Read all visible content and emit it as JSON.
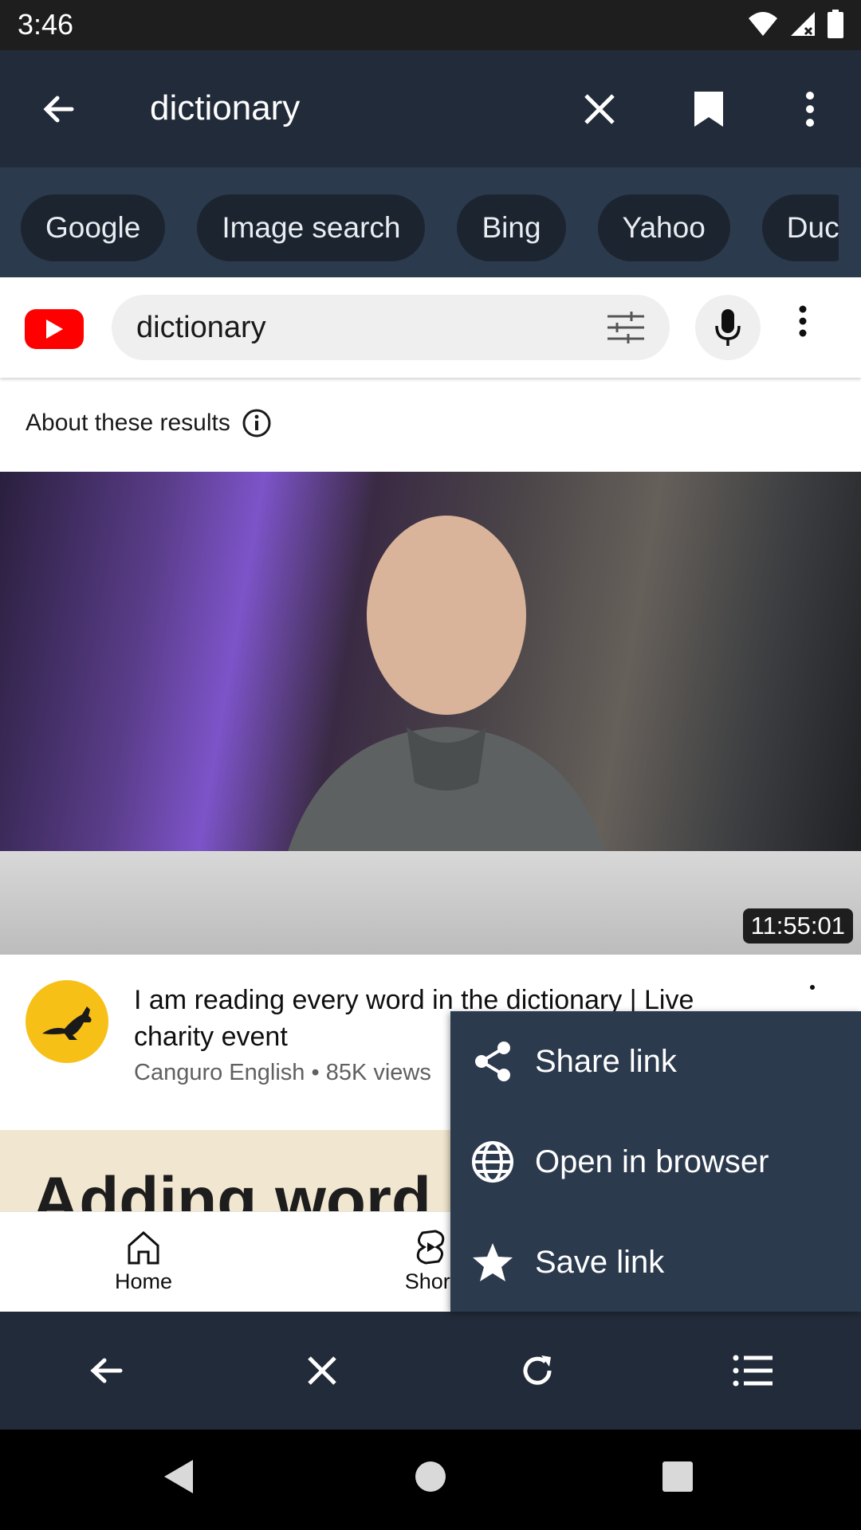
{
  "status_bar": {
    "time": "3:46"
  },
  "toolbar": {
    "query": "dictionary"
  },
  "engines": [
    "Google",
    "Image search",
    "Bing",
    "Yahoo",
    "Duc"
  ],
  "youtube": {
    "search_value": "dictionary",
    "about": "About these results",
    "video": {
      "duration": "11:55:01",
      "title": "I am reading every word in the dictionary | Live charity event",
      "channel": "Canguro English",
      "views": "85K views"
    },
    "next_thumbnail_text": "Adding word",
    "bottom_nav": {
      "home": "Home",
      "shorts": "Short"
    }
  },
  "context_menu": {
    "share": "Share link",
    "open": "Open in browser",
    "save": "Save link"
  },
  "colors": {
    "toolbar": "#222b39",
    "engine_bar": "#2c3a4e",
    "chip": "#1c2430",
    "youtube_red": "#ff0000",
    "channel_yellow": "#f6c017"
  }
}
